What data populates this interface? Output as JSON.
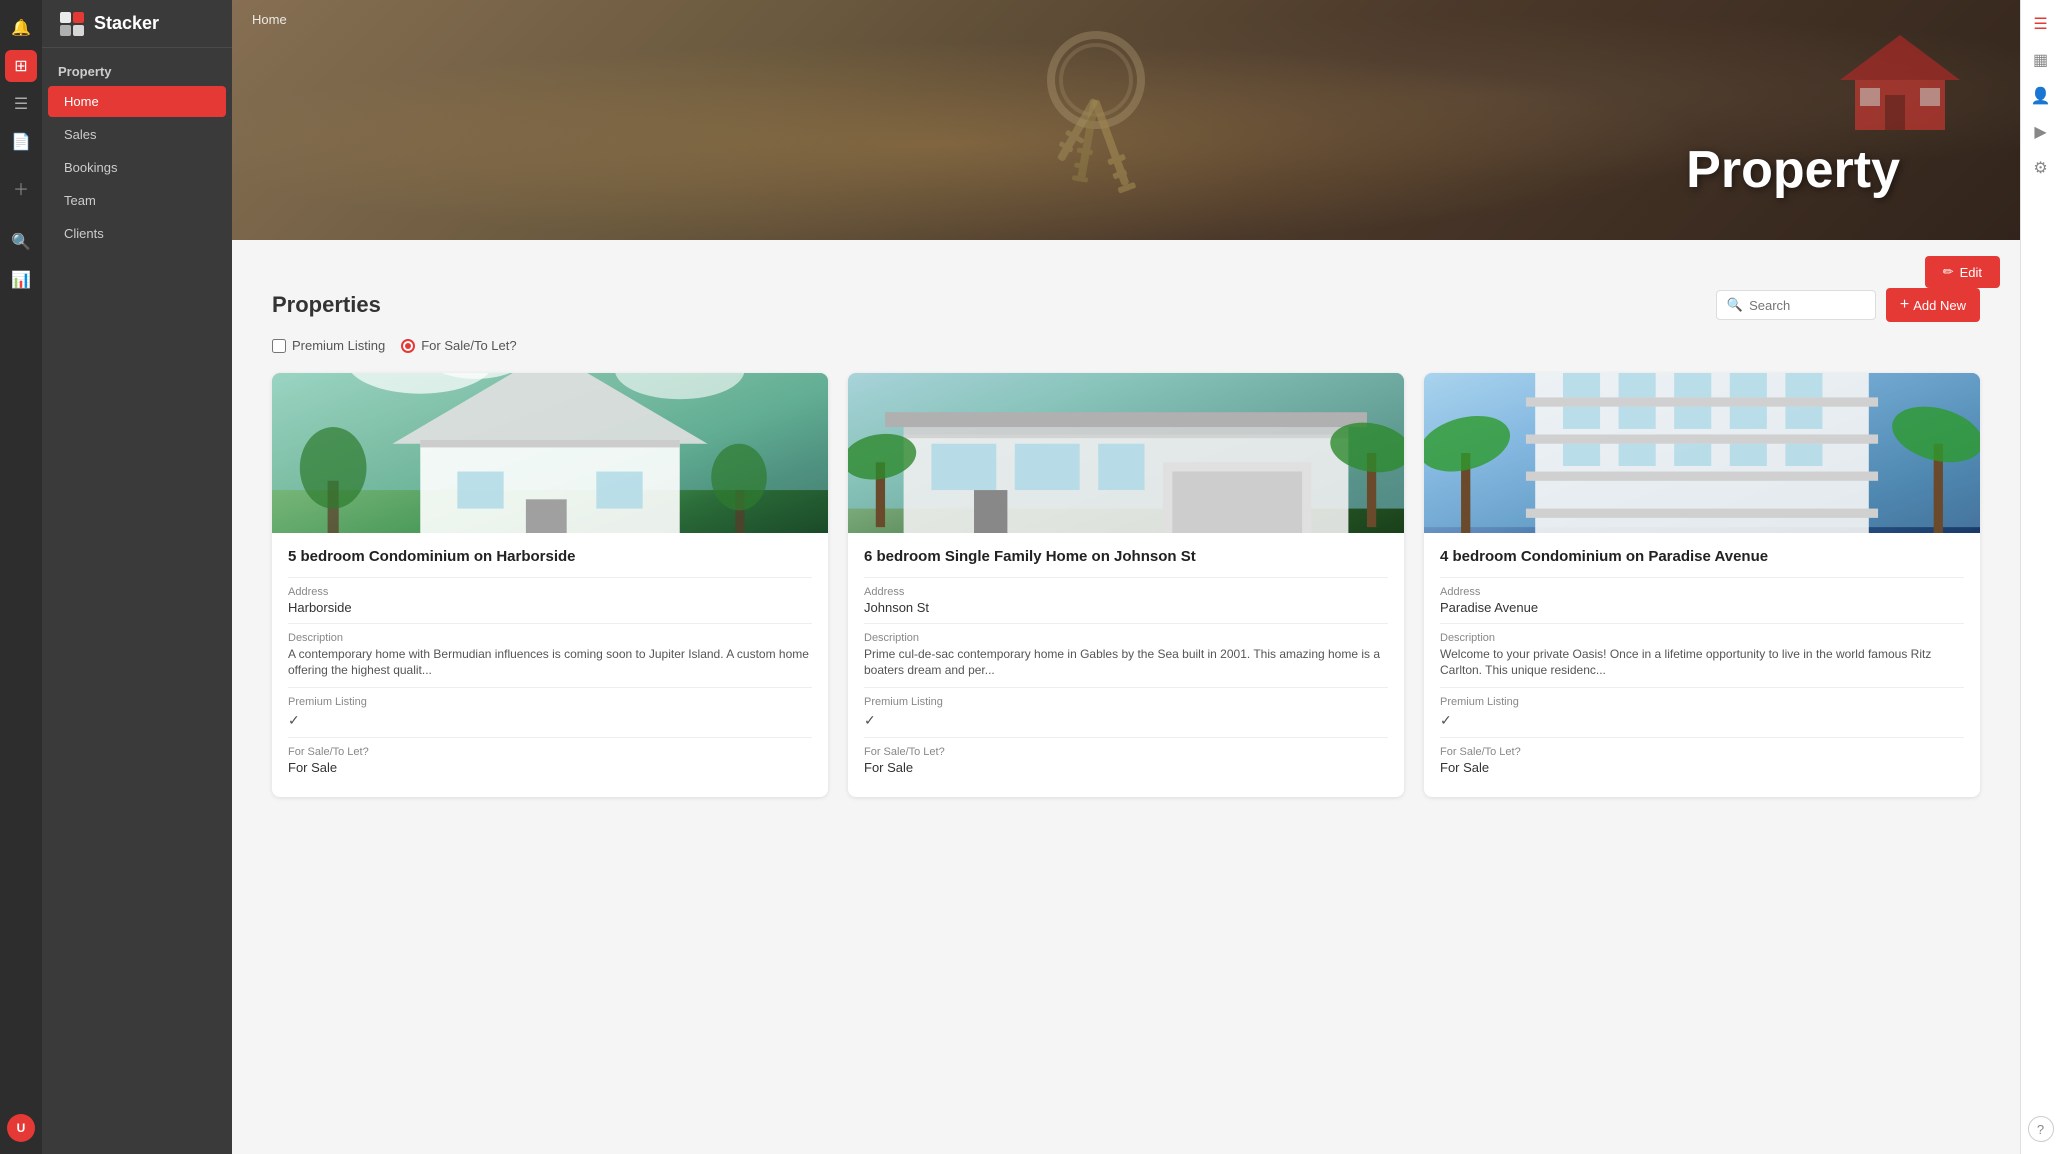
{
  "app": {
    "name": "Stacker"
  },
  "breadcrumb": "Home",
  "hero": {
    "title": "Property"
  },
  "sidebar": {
    "section_label": "Property",
    "items": [
      {
        "id": "home",
        "label": "Home",
        "active": true
      },
      {
        "id": "sales",
        "label": "Sales",
        "active": false
      },
      {
        "id": "bookings",
        "label": "Bookings",
        "active": false
      },
      {
        "id": "team",
        "label": "Team",
        "active": false
      },
      {
        "id": "clients",
        "label": "Clients",
        "active": false
      }
    ]
  },
  "edit_button": "Edit",
  "properties": {
    "title": "Properties",
    "search_placeholder": "Search",
    "add_new_label": "Add New",
    "filters": [
      {
        "id": "premium_listing",
        "label": "Premium Listing",
        "type": "checkbox"
      },
      {
        "id": "for_sale",
        "label": "For Sale/To Let?",
        "type": "radio"
      }
    ],
    "cards": [
      {
        "id": 1,
        "title": "5 bedroom Condominium on Harborside",
        "address_label": "Address",
        "address": "Harborside",
        "description_label": "Description",
        "description": "A contemporary home with Bermudian influences is coming soon to Jupiter Island. A custom home offering the highest qualit...",
        "premium_listing_label": "Premium Listing",
        "for_sale_label": "For Sale/To Let?",
        "for_sale_value": "For Sale",
        "color_from": "#a8c5a0",
        "color_to": "#3d7a3d"
      },
      {
        "id": 2,
        "title": "6 bedroom Single Family Home on Johnson St",
        "address_label": "Address",
        "address": "Johnson St",
        "description_label": "Description",
        "description": "Prime cul-de-sac contemporary home in Gables by the Sea built in 2001. This amazing home is a boaters dream and per...",
        "premium_listing_label": "Premium Listing",
        "for_sale_label": "For Sale/To Let?",
        "for_sale_value": "For Sale",
        "color_from": "#c5d5c5",
        "color_to": "#3a6a4a"
      },
      {
        "id": 3,
        "title": "4 bedroom Condominium on Paradise Avenue",
        "address_label": "Address",
        "address": "Paradise Avenue",
        "description_label": "Description",
        "description": "Welcome to your private Oasis! Once in a lifetime opportunity to live in the world famous Ritz Carlton. This unique residenc...",
        "premium_listing_label": "Premium Listing",
        "for_sale_label": "For Sale/To Let?",
        "for_sale_value": "For Sale",
        "color_from": "#b0c8e0",
        "color_to": "#3a5a88"
      }
    ]
  },
  "right_panel": {
    "icons": [
      "list-icon",
      "calendar-icon",
      "person-icon",
      "chevron-right-icon",
      "gear-icon"
    ],
    "help_label": "?"
  }
}
